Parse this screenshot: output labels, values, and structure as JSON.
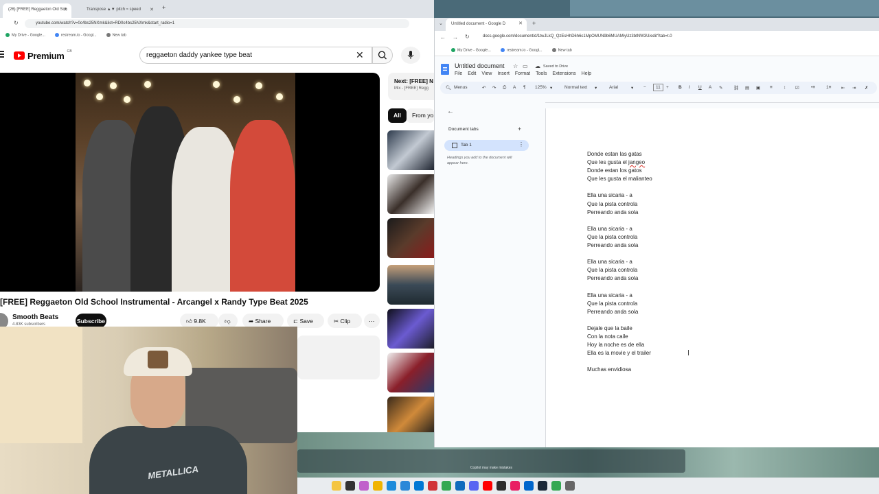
{
  "yt_browser": {
    "tabs": [
      {
        "label": "(26) [FREE] Reggaeton Old Sch",
        "active": true
      },
      {
        "label": "Transpose ▲▼ pitch ≈ speed",
        "active": false
      }
    ],
    "url": "youtube.com/watch?v=0c4bs25NXmk&list=RD0c4bs25NXmk&start_radio=1",
    "bookmarks": [
      "My Drive - Google...",
      "restream.io - Googl...",
      "New tab"
    ]
  },
  "youtube": {
    "logo": "Premium",
    "region": "GB",
    "search_value": "reggaeton daddy yankee type beat",
    "video_title": "[FREE] Reggaeton Old School Instrumental - Arcangel x Randy Type Beat 2025",
    "channel_name": "Smooth Beats",
    "subscribers": "4.83K subscribers",
    "subscribe_label": "Subscribe",
    "likes": "9.8K",
    "share_label": "Share",
    "save_label": "Save",
    "clip_label": "Clip",
    "next_label": "Next:",
    "next_title": "[FREE] N",
    "next_sub": "Mix - [FREE] Regg",
    "chips": [
      "All",
      "From yo"
    ]
  },
  "webcam": {
    "shirt_text": "METALLICA"
  },
  "gd_browser": {
    "tab_label": "Untitled document - Google D",
    "url": "docs.google.com/document/d/1twJLkQ_QzEsHhD6h6c1MpOMUN9b6MUAMiyUz3btNW3U/edit?tab=t.0",
    "bookmarks": [
      "My Drive - Google...",
      "restream.io - Googl...",
      "New tab"
    ]
  },
  "gdocs": {
    "doc_title": "Untitled document",
    "saved_status": "Saved to Drive",
    "menu": [
      "File",
      "Edit",
      "View",
      "Insert",
      "Format",
      "Tools",
      "Extensions",
      "Help"
    ],
    "toolbar": {
      "menus": "Menus",
      "zoom": "125%",
      "style": "Normal text",
      "font": "Arial",
      "font_size": "11"
    },
    "sidebar": {
      "heading": "Document tabs",
      "tab_name": "Tab 1",
      "hint": "Headings you add to the document will appear here."
    },
    "lines": [
      "Donde estan las gatas",
      "Que les gusta el jangeo",
      "Donde estan los gatos",
      "Que les gusta el malianteo",
      "",
      "Ella una sicaria - a",
      "Que la pista controla",
      "Perreando anda sola",
      "",
      "Ella una sicaria - a",
      "Que la pista controla",
      "Perreando anda sola",
      "",
      "Ella una sicaria - a",
      "Que la pista controla",
      "Perreando anda sola",
      "",
      "Ella una sicaria - a",
      "Que la pista controla",
      "Perreando anda sola",
      "",
      "Dejale que la baile",
      "Con la nota caile",
      "Hoy la noche es de ella",
      "Ella es la movie y el trailer",
      "",
      "Muchas envidiosa"
    ]
  },
  "desktop": {
    "copilot_note": "Copilot may make mistakes"
  }
}
